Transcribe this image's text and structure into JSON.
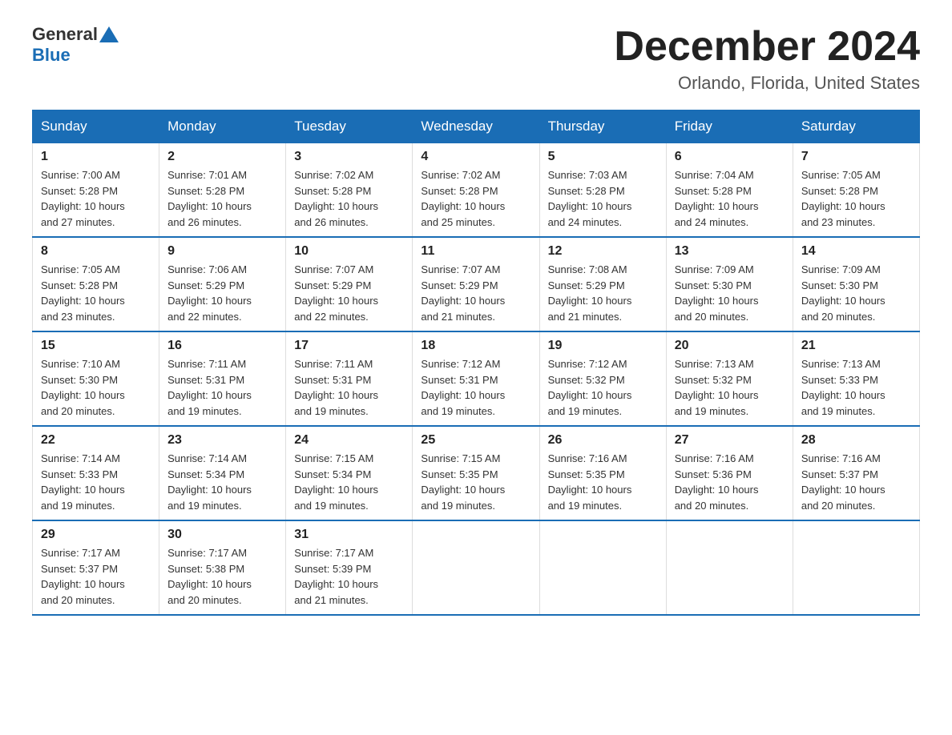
{
  "logo": {
    "general": "General",
    "blue": "Blue"
  },
  "title": {
    "month": "December 2024",
    "location": "Orlando, Florida, United States"
  },
  "headers": [
    "Sunday",
    "Monday",
    "Tuesday",
    "Wednesday",
    "Thursday",
    "Friday",
    "Saturday"
  ],
  "weeks": [
    [
      {
        "day": "1",
        "sunrise": "7:00 AM",
        "sunset": "5:28 PM",
        "daylight": "10 hours and 27 minutes."
      },
      {
        "day": "2",
        "sunrise": "7:01 AM",
        "sunset": "5:28 PM",
        "daylight": "10 hours and 26 minutes."
      },
      {
        "day": "3",
        "sunrise": "7:02 AM",
        "sunset": "5:28 PM",
        "daylight": "10 hours and 26 minutes."
      },
      {
        "day": "4",
        "sunrise": "7:02 AM",
        "sunset": "5:28 PM",
        "daylight": "10 hours and 25 minutes."
      },
      {
        "day": "5",
        "sunrise": "7:03 AM",
        "sunset": "5:28 PM",
        "daylight": "10 hours and 24 minutes."
      },
      {
        "day": "6",
        "sunrise": "7:04 AM",
        "sunset": "5:28 PM",
        "daylight": "10 hours and 24 minutes."
      },
      {
        "day": "7",
        "sunrise": "7:05 AM",
        "sunset": "5:28 PM",
        "daylight": "10 hours and 23 minutes."
      }
    ],
    [
      {
        "day": "8",
        "sunrise": "7:05 AM",
        "sunset": "5:28 PM",
        "daylight": "10 hours and 23 minutes."
      },
      {
        "day": "9",
        "sunrise": "7:06 AM",
        "sunset": "5:29 PM",
        "daylight": "10 hours and 22 minutes."
      },
      {
        "day": "10",
        "sunrise": "7:07 AM",
        "sunset": "5:29 PM",
        "daylight": "10 hours and 22 minutes."
      },
      {
        "day": "11",
        "sunrise": "7:07 AM",
        "sunset": "5:29 PM",
        "daylight": "10 hours and 21 minutes."
      },
      {
        "day": "12",
        "sunrise": "7:08 AM",
        "sunset": "5:29 PM",
        "daylight": "10 hours and 21 minutes."
      },
      {
        "day": "13",
        "sunrise": "7:09 AM",
        "sunset": "5:30 PM",
        "daylight": "10 hours and 20 minutes."
      },
      {
        "day": "14",
        "sunrise": "7:09 AM",
        "sunset": "5:30 PM",
        "daylight": "10 hours and 20 minutes."
      }
    ],
    [
      {
        "day": "15",
        "sunrise": "7:10 AM",
        "sunset": "5:30 PM",
        "daylight": "10 hours and 20 minutes."
      },
      {
        "day": "16",
        "sunrise": "7:11 AM",
        "sunset": "5:31 PM",
        "daylight": "10 hours and 19 minutes."
      },
      {
        "day": "17",
        "sunrise": "7:11 AM",
        "sunset": "5:31 PM",
        "daylight": "10 hours and 19 minutes."
      },
      {
        "day": "18",
        "sunrise": "7:12 AM",
        "sunset": "5:31 PM",
        "daylight": "10 hours and 19 minutes."
      },
      {
        "day": "19",
        "sunrise": "7:12 AM",
        "sunset": "5:32 PM",
        "daylight": "10 hours and 19 minutes."
      },
      {
        "day": "20",
        "sunrise": "7:13 AM",
        "sunset": "5:32 PM",
        "daylight": "10 hours and 19 minutes."
      },
      {
        "day": "21",
        "sunrise": "7:13 AM",
        "sunset": "5:33 PM",
        "daylight": "10 hours and 19 minutes."
      }
    ],
    [
      {
        "day": "22",
        "sunrise": "7:14 AM",
        "sunset": "5:33 PM",
        "daylight": "10 hours and 19 minutes."
      },
      {
        "day": "23",
        "sunrise": "7:14 AM",
        "sunset": "5:34 PM",
        "daylight": "10 hours and 19 minutes."
      },
      {
        "day": "24",
        "sunrise": "7:15 AM",
        "sunset": "5:34 PM",
        "daylight": "10 hours and 19 minutes."
      },
      {
        "day": "25",
        "sunrise": "7:15 AM",
        "sunset": "5:35 PM",
        "daylight": "10 hours and 19 minutes."
      },
      {
        "day": "26",
        "sunrise": "7:16 AM",
        "sunset": "5:35 PM",
        "daylight": "10 hours and 19 minutes."
      },
      {
        "day": "27",
        "sunrise": "7:16 AM",
        "sunset": "5:36 PM",
        "daylight": "10 hours and 20 minutes."
      },
      {
        "day": "28",
        "sunrise": "7:16 AM",
        "sunset": "5:37 PM",
        "daylight": "10 hours and 20 minutes."
      }
    ],
    [
      {
        "day": "29",
        "sunrise": "7:17 AM",
        "sunset": "5:37 PM",
        "daylight": "10 hours and 20 minutes."
      },
      {
        "day": "30",
        "sunrise": "7:17 AM",
        "sunset": "5:38 PM",
        "daylight": "10 hours and 20 minutes."
      },
      {
        "day": "31",
        "sunrise": "7:17 AM",
        "sunset": "5:39 PM",
        "daylight": "10 hours and 21 minutes."
      },
      null,
      null,
      null,
      null
    ]
  ],
  "labels": {
    "sunrise": "Sunrise:",
    "sunset": "Sunset:",
    "daylight": "Daylight:"
  }
}
